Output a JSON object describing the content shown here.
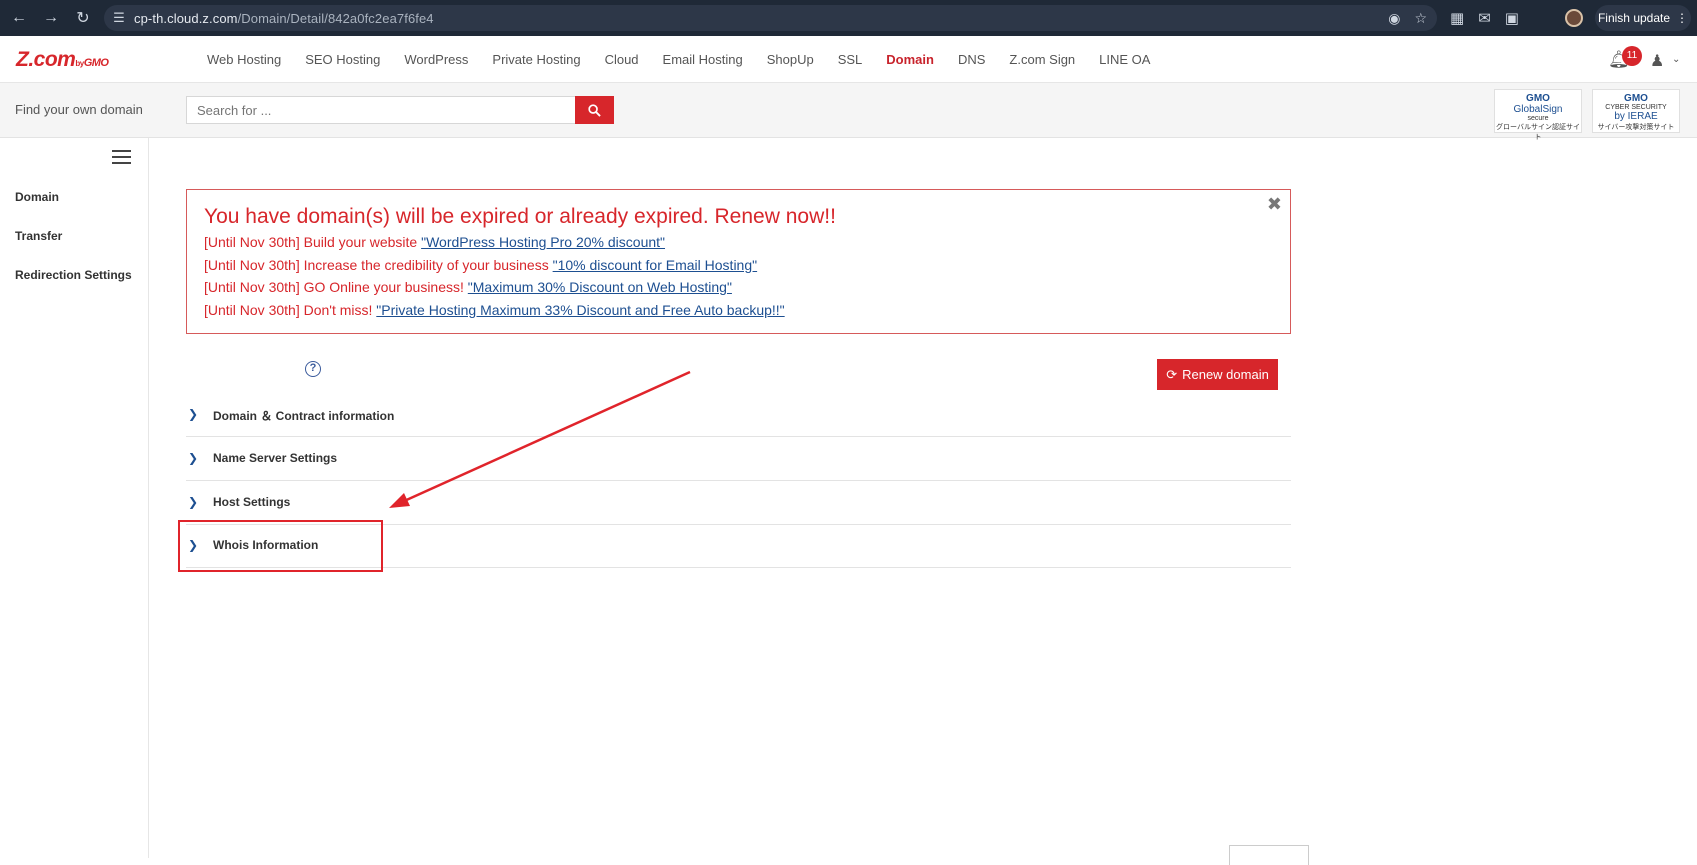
{
  "browser": {
    "url_host": "cp-th.cloud.z.com",
    "url_path": "/Domain/Detail/842a0fc2ea7f6fe4",
    "finish_update_label": "Finish update",
    "ext_badge": "1"
  },
  "topnav": {
    "logo_text": "Z.com",
    "logo_by": "by",
    "logo_gmo": "GMO",
    "items": [
      {
        "label": "Web Hosting"
      },
      {
        "label": "SEO Hosting"
      },
      {
        "label": "WordPress"
      },
      {
        "label": "Private Hosting"
      },
      {
        "label": "Cloud"
      },
      {
        "label": "Email Hosting"
      },
      {
        "label": "ShopUp"
      },
      {
        "label": "SSL"
      },
      {
        "label": "Domain"
      },
      {
        "label": "DNS"
      },
      {
        "label": "Z.com Sign"
      },
      {
        "label": "LINE OA"
      }
    ],
    "active_item": "Domain",
    "notification_count": "11"
  },
  "search": {
    "label": "Find your own domain",
    "placeholder": "Search for ..."
  },
  "seals": {
    "globalsign": {
      "brand": "GMO",
      "name": "GlobalSign",
      "sub": "secure",
      "caption": "グローバルサイン認証サイト"
    },
    "ierae": {
      "brand": "GMO",
      "name": "CYBER SECURITY",
      "sub": "by IERAE",
      "caption": "サイバー攻撃対策サイト"
    }
  },
  "sidebar": {
    "items": [
      {
        "label": "Domain"
      },
      {
        "label": "Transfer"
      },
      {
        "label": "Redirection Settings"
      }
    ]
  },
  "alert": {
    "title": "You have domain(s) will be expired or already expired. Renew now!!",
    "lines": [
      {
        "prefix": "[Until Nov 30th] Build your website ",
        "link": "\"WordPress Hosting Pro 20% discount\""
      },
      {
        "prefix": "[Until Nov 30th] Increase the credibility of your business ",
        "link": "\"10% discount for Email Hosting\""
      },
      {
        "prefix": "[Until Nov 30th] GO Online your business! ",
        "link": "\"Maximum 30% Discount on Web Hosting\""
      },
      {
        "prefix": "[Until Nov 30th] Don't miss! ",
        "link": "\"Private Hosting Maximum 33% Discount and Free Auto backup!!\""
      }
    ]
  },
  "actions": {
    "renew_label": "Renew domain"
  },
  "accordion": [
    {
      "title": "Domain ＆ Contract information"
    },
    {
      "title": "Name Server Settings"
    },
    {
      "title": "Host Settings"
    },
    {
      "title": "Whois Information"
    }
  ],
  "colors": {
    "brand_red": "#d7262b",
    "link_blue": "#1d4f91",
    "annotation_red": "#e0242b"
  }
}
